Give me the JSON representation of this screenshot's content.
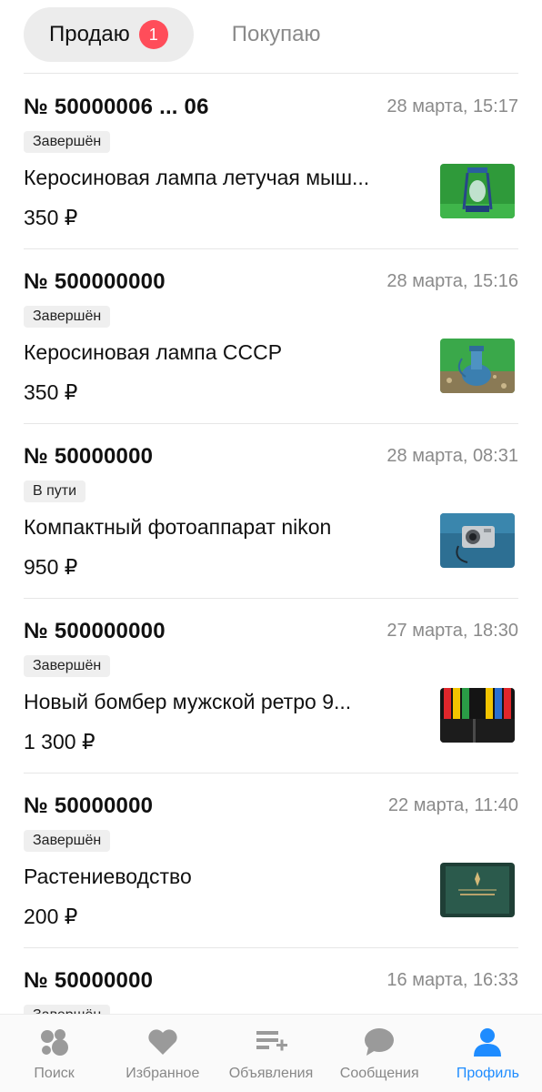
{
  "tabs": {
    "selling": {
      "label": "Продаю",
      "badge": "1"
    },
    "buying": {
      "label": "Покупаю"
    }
  },
  "orders": [
    {
      "number": "№ 50000006 ... 06",
      "date": "28 марта, 15:17",
      "status": "Завершён",
      "title": "Керосиновая лампа летучая мыш...",
      "price": "350 ₽",
      "thumb": "kerosene-lamp-green"
    },
    {
      "number": "№ 500000000",
      "date": "28 марта, 15:16",
      "status": "Завершён",
      "title": "Керосиновая лампа СССР",
      "price": "350 ₽",
      "thumb": "kerosene-lamp-blue"
    },
    {
      "number": "№ 50000000",
      "date": "28 марта, 08:31",
      "status": "В пути",
      "title": "Компактный фотоаппарат nikon",
      "price": "950 ₽",
      "thumb": "camera"
    },
    {
      "number": "№ 500000000",
      "date": "27 марта, 18:30",
      "status": "Завершён",
      "title": "Новый бомбер мужской ретро 9...",
      "price": "1 300 ₽",
      "thumb": "bomber-jacket"
    },
    {
      "number": "№ 50000000",
      "date": "22 марта, 11:40",
      "status": "Завершён",
      "title": "Растениеводство",
      "price": "200 ₽",
      "thumb": "book"
    },
    {
      "number": "№ 50000000",
      "date": "16 марта, 16:33",
      "status": "Завершён",
      "title": "",
      "price": "",
      "thumb": ""
    }
  ],
  "nav": {
    "search": {
      "label": "Поиск",
      "icon": "search-dots-icon"
    },
    "favorites": {
      "label": "Избранное",
      "icon": "heart-icon"
    },
    "ads": {
      "label": "Объявления",
      "icon": "listings-add-icon"
    },
    "messages": {
      "label": "Сообщения",
      "icon": "chat-bubble-icon"
    },
    "profile": {
      "label": "Профиль",
      "icon": "user-icon",
      "active": true
    }
  },
  "colors": {
    "accent": "#1e8cff",
    "badge": "#ff4d5a",
    "muted": "#8a8a8a"
  }
}
